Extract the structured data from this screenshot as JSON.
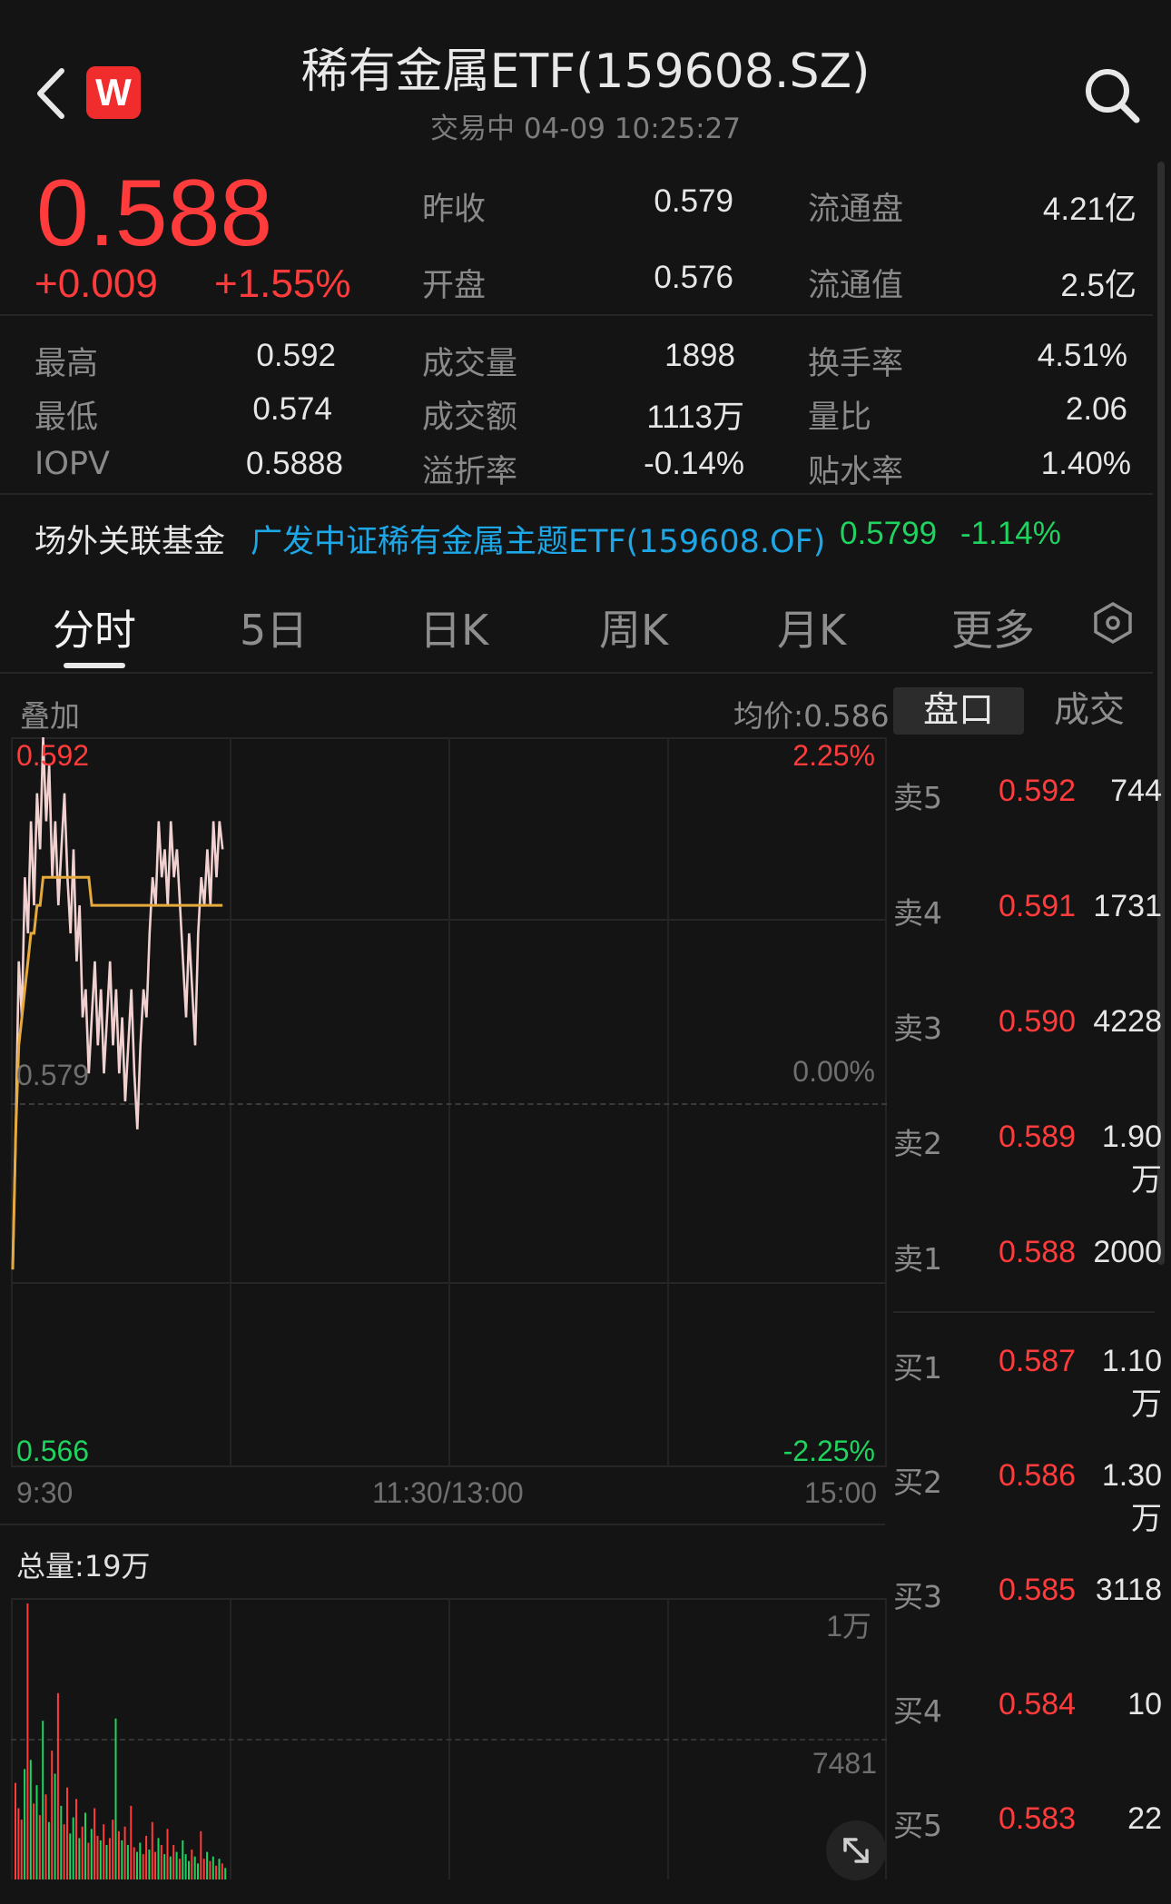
{
  "header": {
    "title": "稀有金属ETF(159608.SZ)",
    "status": "交易中 04-09 10:25:27",
    "logo_text": "W"
  },
  "quote": {
    "price": "0.588",
    "change": "+0.009",
    "change_pct": "+1.55%",
    "top_rows": [
      {
        "l1": "昨收",
        "v1": "0.579",
        "l2": "流通盘",
        "v2": "4.21亿"
      },
      {
        "l1": "开盘",
        "v1": "0.576",
        "l2": "流通值",
        "v2": "2.5亿"
      }
    ],
    "grid_rows": [
      {
        "l1": "最高",
        "v1": "0.592",
        "l2": "成交量",
        "v2": "1898",
        "l3": "换手率",
        "v3": "4.51%"
      },
      {
        "l1": "最低",
        "v1": "0.574",
        "l2": "成交额",
        "v2": "1113万",
        "l3": "量比",
        "v3": "2.06"
      },
      {
        "l1": "IOPV",
        "v1": "0.5888",
        "l2": "溢折率",
        "v2": "-0.14%",
        "l3": "贴水率",
        "v3": "1.40%"
      }
    ]
  },
  "related": {
    "label": "场外关联基金",
    "fund": "广发中证稀有金属主题ETF(159608.OF)",
    "price": "0.5799",
    "pct": "-1.14%"
  },
  "tabs": [
    "分时",
    "5日",
    "日K",
    "周K",
    "月K",
    "更多"
  ],
  "chart": {
    "overlay_label": "叠加",
    "avg_label": "均价:0.586",
    "y_top": "0.592",
    "y_mid": "0.579",
    "y_bottom": "0.566",
    "pct_top": "2.25%",
    "pct_mid": "0.00%",
    "pct_bottom": "-2.25%",
    "t_start": "9:30",
    "t_mid": "11:30/13:00",
    "t_end": "15:00",
    "volume_total": "总量:19万",
    "vol_axis_top": "1万",
    "vol_axis_mid": "7481"
  },
  "chart_data": {
    "type": "line",
    "series": [
      {
        "name": "price",
        "values": [
          0.573,
          0.578,
          0.584,
          0.582,
          0.587,
          0.585,
          0.589,
          0.586,
          0.59,
          0.588,
          0.592,
          0.589,
          0.591,
          0.587,
          0.589,
          0.586,
          0.588,
          0.59,
          0.587,
          0.585,
          0.588,
          0.584,
          0.586,
          0.582,
          0.583,
          0.58,
          0.582,
          0.584,
          0.581,
          0.583,
          0.58,
          0.582,
          0.584,
          0.581,
          0.583,
          0.58,
          0.582,
          0.579,
          0.581,
          0.583,
          0.58,
          0.578,
          0.581,
          0.583,
          0.582,
          0.585,
          0.587,
          0.586,
          0.589,
          0.587,
          0.588,
          0.586,
          0.589,
          0.587,
          0.588,
          0.586,
          0.584,
          0.582,
          0.585,
          0.583,
          0.581,
          0.585,
          0.587,
          0.586,
          0.588,
          0.586,
          0.589,
          0.587,
          0.589,
          0.588
        ]
      },
      {
        "name": "avg",
        "values": [
          0.573,
          0.578,
          0.581,
          0.582,
          0.583,
          0.584,
          0.585,
          0.585,
          0.586,
          0.586,
          0.587,
          0.587,
          0.587,
          0.587,
          0.587,
          0.587,
          0.587,
          0.587,
          0.587,
          0.587,
          0.587,
          0.587,
          0.587,
          0.587,
          0.587,
          0.587,
          0.586,
          0.586,
          0.586,
          0.586,
          0.586,
          0.586,
          0.586,
          0.586,
          0.586,
          0.586,
          0.586,
          0.586,
          0.586,
          0.586,
          0.586,
          0.586,
          0.586,
          0.586,
          0.586,
          0.586,
          0.586,
          0.586,
          0.586,
          0.586,
          0.586,
          0.586,
          0.586,
          0.586,
          0.586,
          0.586,
          0.586,
          0.586,
          0.586,
          0.586,
          0.586,
          0.586,
          0.586,
          0.586,
          0.586,
          0.586,
          0.586,
          0.586,
          0.586,
          0.586
        ]
      }
    ],
    "ylim": [
      0.566,
      0.592
    ],
    "volumes": [
      4200,
      3100,
      2600,
      4800,
      12000,
      5200,
      3300,
      4100,
      2800,
      6900,
      3700,
      2500,
      5600,
      4600,
      8100,
      3200,
      2400,
      4000,
      2000,
      2700,
      3500,
      1800,
      2300,
      2900,
      1600,
      2200,
      3100,
      1900,
      1700,
      2400,
      1500,
      1800,
      2600,
      7000,
      2100,
      1700,
      2300,
      1500,
      3200,
      1400,
      1200,
      1600,
      1100,
      1900,
      1300,
      2500,
      1200,
      1800,
      1500,
      1100,
      2200,
      1000,
      1500,
      1200,
      900,
      1700,
      1100,
      800,
      1300,
      1000,
      700,
      2100,
      900,
      1200,
      800,
      1000,
      600,
      900,
      700,
      500
    ],
    "vol_max": 12000
  },
  "orderbook": {
    "tabs": [
      "盘口",
      "成交"
    ],
    "asks": [
      {
        "label": "卖5",
        "price": "0.592",
        "vol": "744"
      },
      {
        "label": "卖4",
        "price": "0.591",
        "vol": "1731"
      },
      {
        "label": "卖3",
        "price": "0.590",
        "vol": "4228"
      },
      {
        "label": "卖2",
        "price": "0.589",
        "vol": "1.90万"
      },
      {
        "label": "卖1",
        "price": "0.588",
        "vol": "2000"
      }
    ],
    "bids": [
      {
        "label": "买1",
        "price": "0.587",
        "vol": "1.10万"
      },
      {
        "label": "买2",
        "price": "0.586",
        "vol": "1.30万"
      },
      {
        "label": "买3",
        "price": "0.585",
        "vol": "3118"
      },
      {
        "label": "买4",
        "price": "0.584",
        "vol": "10"
      },
      {
        "label": "买5",
        "price": "0.583",
        "vol": "22"
      }
    ]
  },
  "colors": {
    "up": "#ff3b3b",
    "down": "#1fd35e",
    "link": "#1ea7e6",
    "avg": "#e6a93c",
    "price_line": "#f1d0d0"
  }
}
